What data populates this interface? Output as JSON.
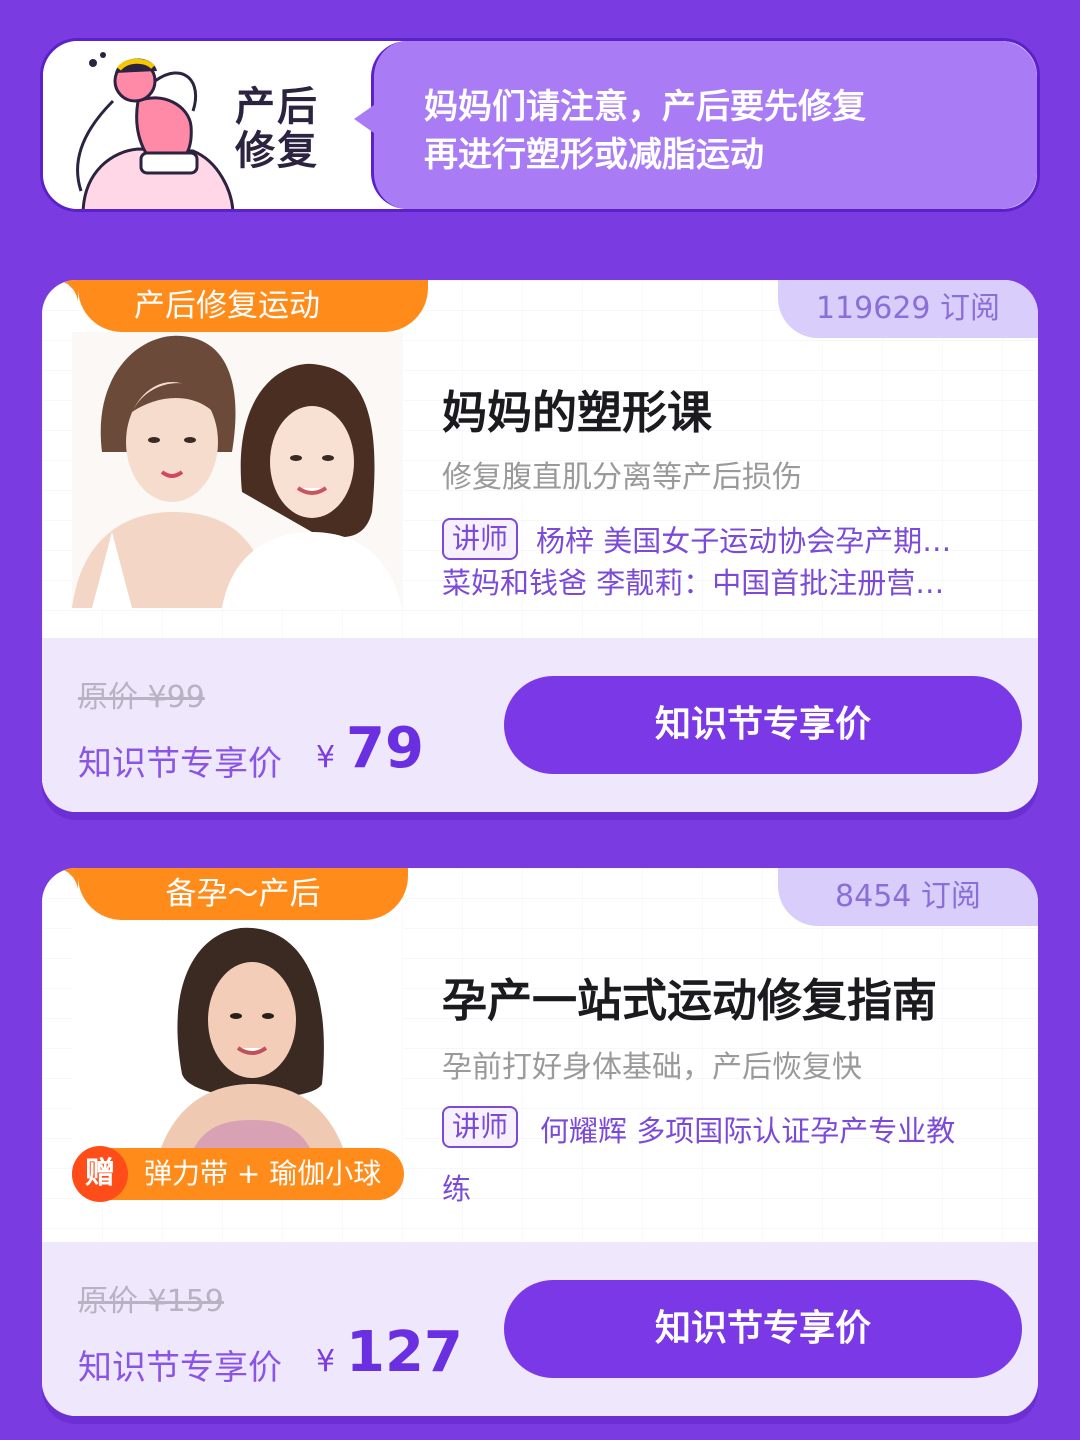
{
  "banner": {
    "title_line1": "产后",
    "title_line2": "修复",
    "message_line1": "妈妈们请注意，产后要先修复",
    "message_line2": "再进行塑形或减脂运动"
  },
  "courses": [
    {
      "tag": "产后修复运动",
      "subscribers": "119629 订阅",
      "title": "妈妈的塑形课",
      "subtitle": "修复腹直肌分离等产后损伤",
      "teacher_badge": "讲师",
      "teacher_line1": "杨梓 美国女子运动协会孕产期…",
      "teacher_line2": "菜妈和钱爸 李靓莉：中国首批注册营…",
      "original_price": "原价 ¥99",
      "promo_label": "知识节专享价",
      "currency": "¥",
      "price": "79",
      "cta": "知识节专享价"
    },
    {
      "tag": "备孕～产后",
      "subscribers": "8454 订阅",
      "title": "孕产一站式运动修复指南",
      "subtitle": "孕前打好身体基础，产后恢复快",
      "teacher_badge": "讲师",
      "teacher_line1": "何耀辉 多项国际认证孕产专业教",
      "teacher_line2": "练",
      "gift_icon": "赠",
      "gift_text": "弹力带 + 瑜伽小球",
      "original_price": "原价 ¥159",
      "promo_label": "知识节专享价",
      "currency": "¥",
      "price": "127",
      "cta": "知识节专享价"
    }
  ]
}
